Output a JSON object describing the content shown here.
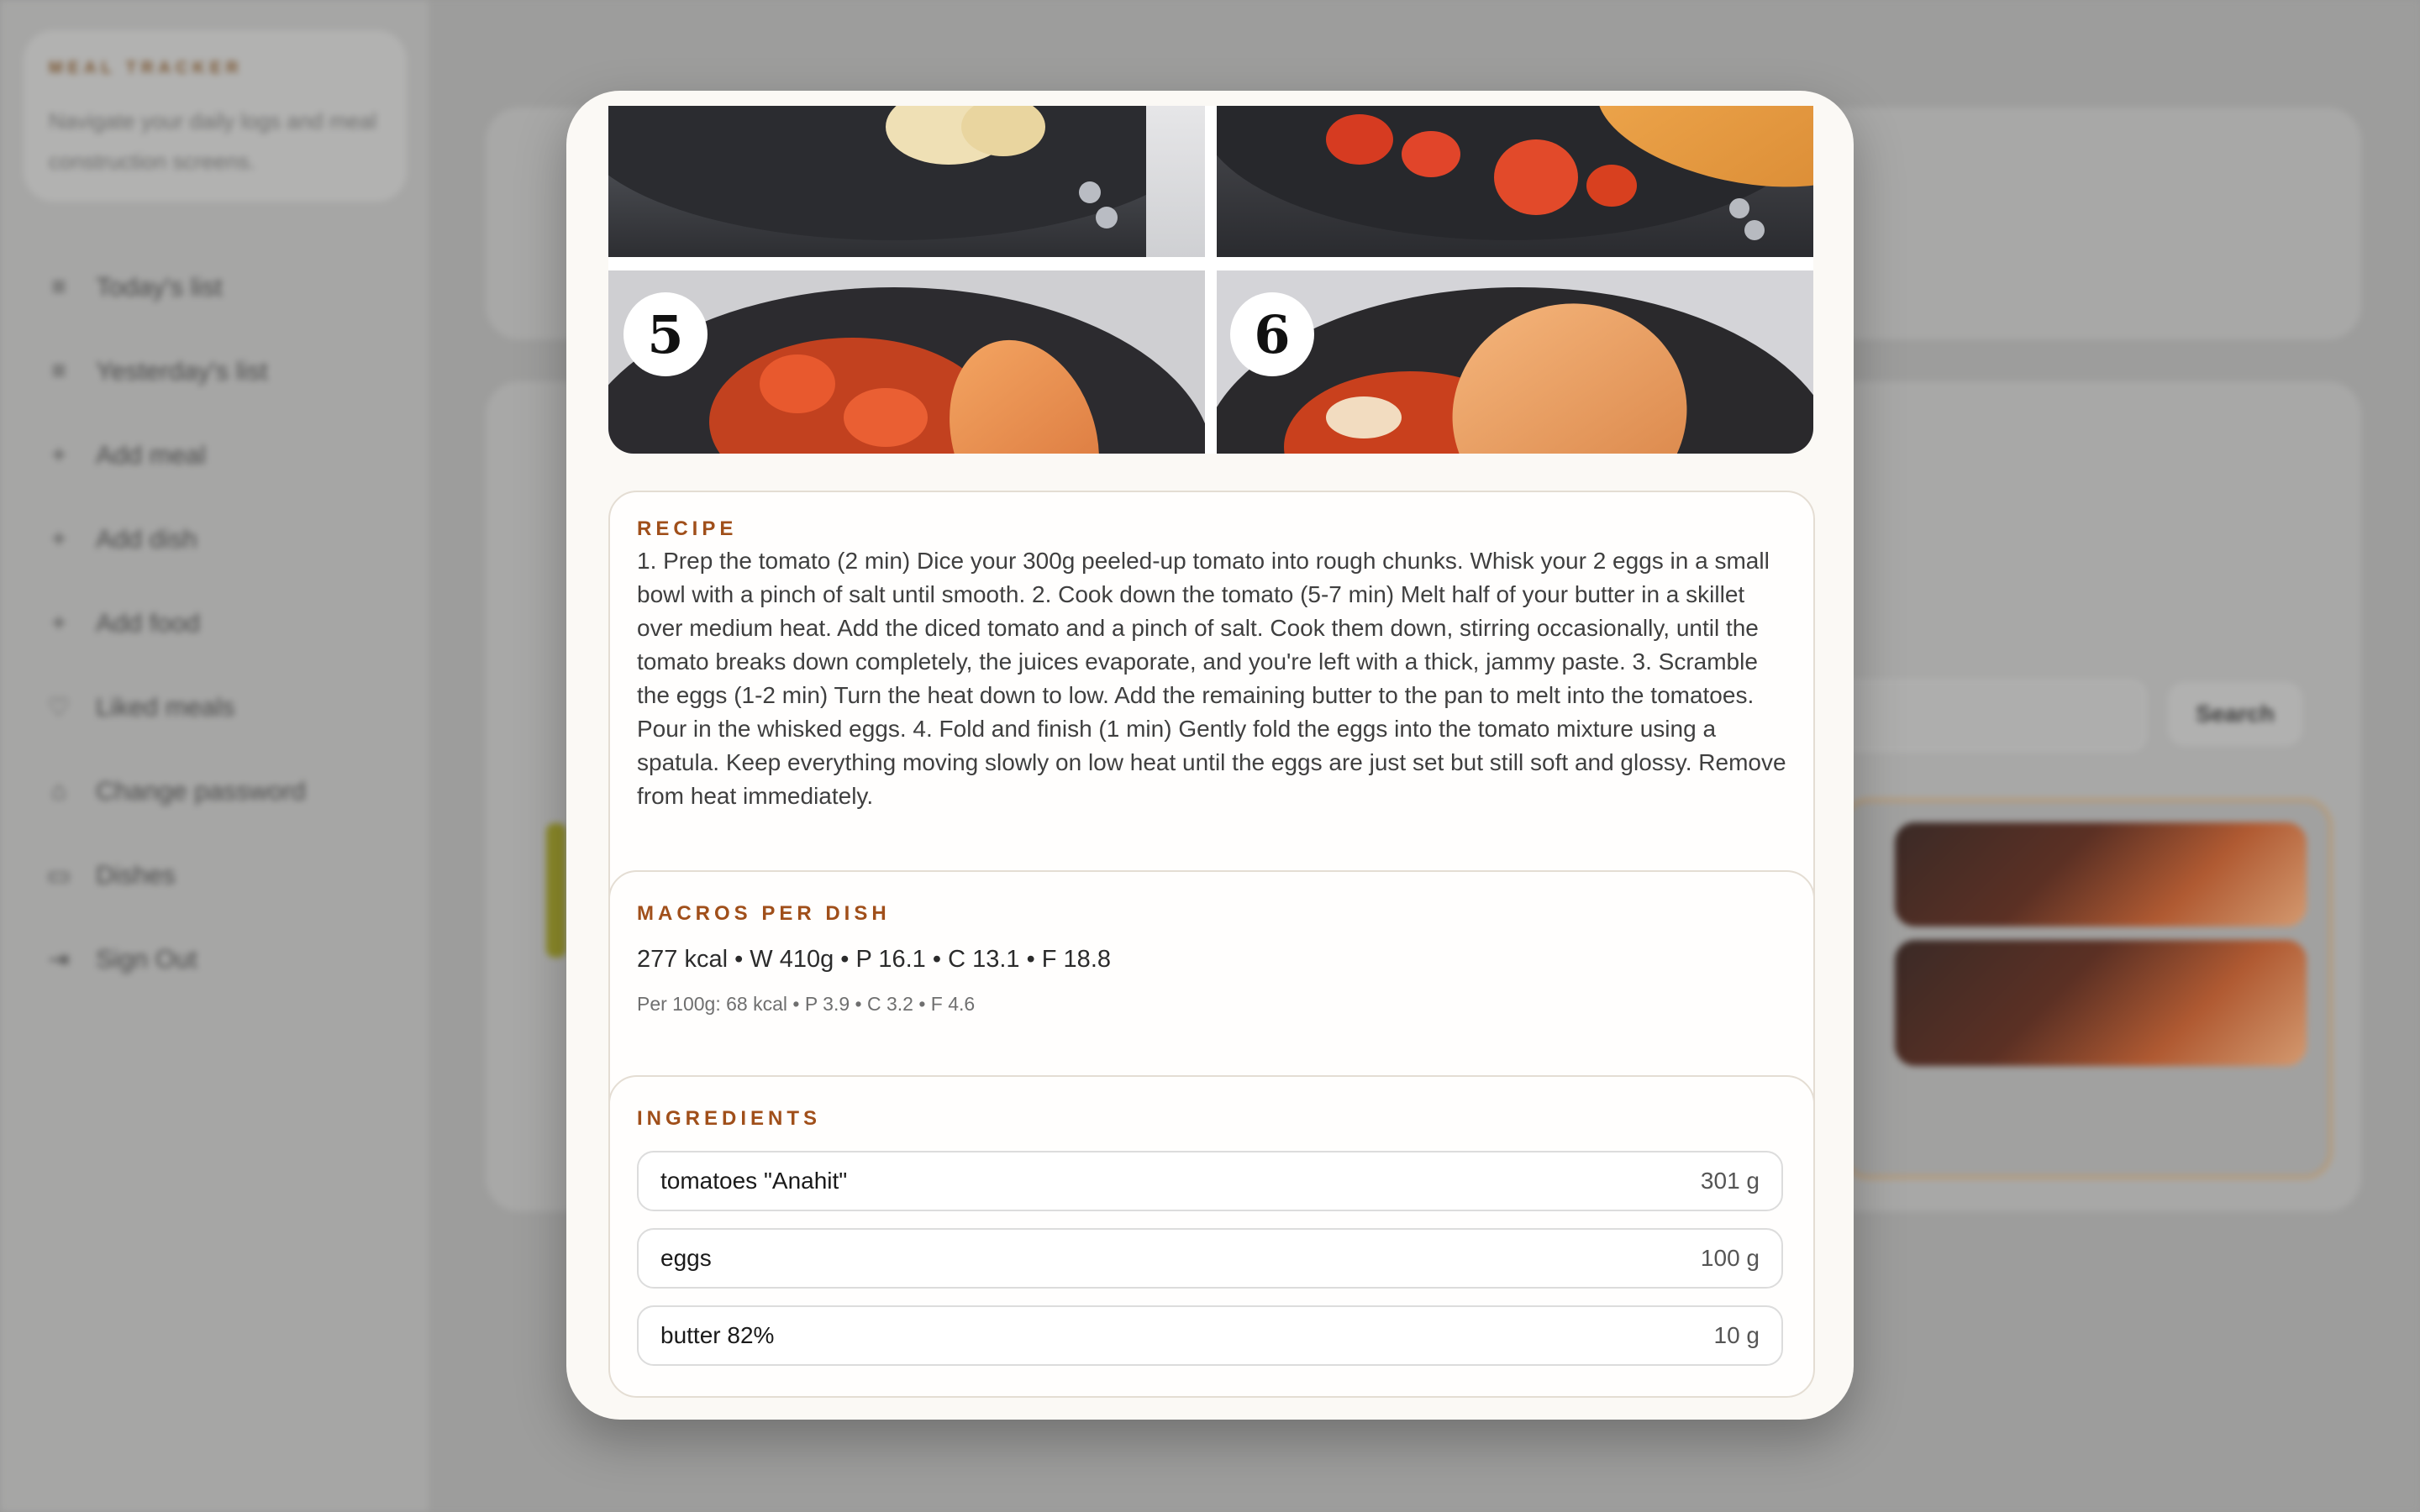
{
  "sidebar": {
    "brand_title": "MEAL TRACKER",
    "brand_subtitle": "Navigate your daily logs and meal construction screens.",
    "items": [
      {
        "label": "Today's list",
        "icon": "list-icon"
      },
      {
        "label": "Yesterday's list",
        "icon": "list-icon"
      },
      {
        "label": "Add meal",
        "icon": "plus-icon"
      },
      {
        "label": "Add dish",
        "icon": "plus-icon"
      },
      {
        "label": "Add food",
        "icon": "plus-icon"
      },
      {
        "label": "Liked meals",
        "icon": "heart-icon"
      },
      {
        "label": "Change password",
        "icon": "lock-icon"
      },
      {
        "label": "Dishes",
        "icon": "pot-icon"
      },
      {
        "label": "Sign Out",
        "icon": "sign-out-icon"
      }
    ]
  },
  "background": {
    "search_button": "Search"
  },
  "modal": {
    "photos": {
      "badge_left": "5",
      "badge_right": "6"
    },
    "recipe": {
      "title": "RECIPE",
      "text": "1. Prep the tomato (2 min) Dice your 300g peeled-up tomato into rough chunks. Whisk your 2 eggs in a small bowl with a pinch of salt until smooth. 2. Cook down the tomato (5-7 min) Melt half of your butter in a skillet over medium heat. Add the diced tomato and a pinch of salt. Cook them down, stirring occasionally, until the tomato breaks down completely, the juices evaporate, and you're left with a thick, jammy paste. 3. Scramble the eggs (1-2 min) Turn the heat down to low. Add the remaining butter to the pan to melt into the tomatoes. Pour in the whisked eggs. 4. Fold and finish (1 min) Gently fold the eggs into the tomato mixture using a spatula. Keep everything moving slowly on low heat until the eggs are just set but still soft and glossy. Remove from heat immediately."
    },
    "macros": {
      "title": "MACROS PER DISH",
      "main": "277 kcal • W 410g • P 16.1 • C 13.1 • F 18.8",
      "per100": "Per 100g: 68 kcal • P 3.9 • C 3.2 • F 4.6"
    },
    "ingredients": {
      "title": "INGREDIENTS",
      "items": [
        {
          "name": "tomatoes \"Anahit\"",
          "qty": "301 g"
        },
        {
          "name": "eggs",
          "qty": "100 g"
        },
        {
          "name": "butter 82%",
          "qty": "10 g"
        }
      ]
    }
  },
  "colors": {
    "accent": "#a04f1a",
    "modal_bg": "#fbf9f5",
    "overlay": "#9a9a99"
  }
}
